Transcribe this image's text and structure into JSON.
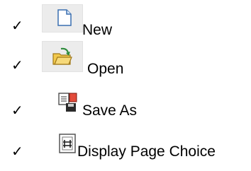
{
  "toolbar": {
    "items": [
      {
        "label": "New",
        "checked": true,
        "icon": "new-document-icon"
      },
      {
        "label": "Open",
        "checked": true,
        "icon": "open-folder-icon"
      },
      {
        "label": "Save As",
        "checked": true,
        "icon": "save-as-icon"
      },
      {
        "label": "Display Page Choice",
        "checked": true,
        "icon": "page-choice-icon"
      }
    ],
    "check_glyph": "✓"
  }
}
